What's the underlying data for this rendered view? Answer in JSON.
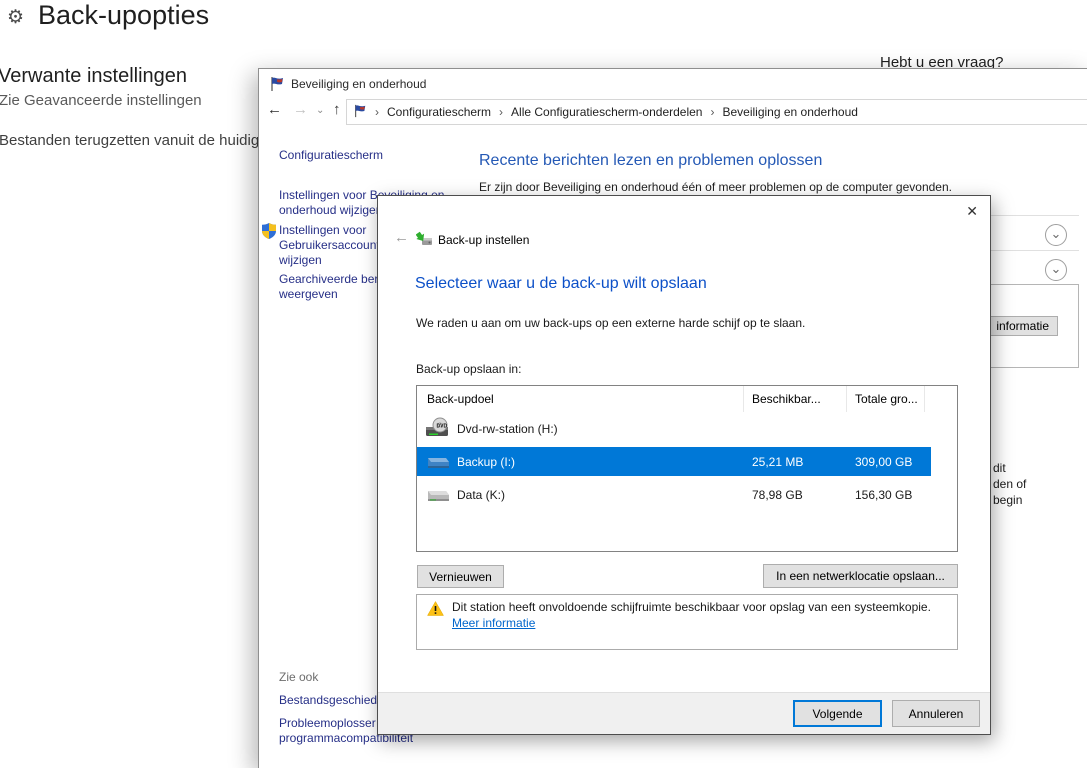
{
  "colors": {
    "accent": "#0078d7",
    "link": "#0066cc",
    "heading": "#0c50c8",
    "heading2": "#2559b5",
    "sidelink": "#262f87",
    "warn": "#fdc116"
  },
  "icons": {
    "gear": "⚙",
    "back-arrow": "←",
    "forward-arrow": "→",
    "up-arrow": "↑",
    "chevron-down": "⌄",
    "breadcrumb-separator": "›",
    "close": "✕"
  },
  "settings": {
    "title": "Back-upopties",
    "related_heading": "Verwante instellingen",
    "related_link1": "Zie Geavanceerde instellingen",
    "related_link2": "Bestanden terugzetten vanuit de huidige back-up",
    "help_heading": "Hebt u een vraag?"
  },
  "control_panel": {
    "window_title": "Beveiliging en onderhoud",
    "breadcrumb": {
      "item1": "Configuratiescherm",
      "item2": "Alle Configuratiescherm-onderdelen",
      "item3": "Beveiliging en onderhoud"
    },
    "sidebar": {
      "home": "Configuratiescherm",
      "item2": {
        "lines": [
          "Instellingen voor Beveiliging en",
          "onderhoud wijzigen"
        ]
      },
      "item3": {
        "lines": [
          "Instellingen voor",
          "Gebruikersaccountbeheer",
          "wijzigen"
        ]
      },
      "item4": {
        "lines": [
          "Gearchiveerde berichten",
          "weergeven"
        ]
      },
      "see_also": "Zie ook",
      "item5": {
        "lines": [
          "Bestandsgeschiedenis"
        ]
      },
      "item6": {
        "lines": [
          "Probleemoplosser voor",
          "programmacompatibiliteit"
        ]
      }
    },
    "main": {
      "heading": "Recente berichten lezen en problemen oplossen",
      "subtext": "Er zijn door Beveiliging en onderhoud één of meer problemen op de computer gevonden.",
      "info_button_fragment": "informatie",
      "fragment1": "dit",
      "fragment2": "den of",
      "fragment3": "begin"
    }
  },
  "dialog": {
    "nav_title": "Back-up instellen",
    "heading": "Selecteer waar u de back-up wilt opslaan",
    "subtext": "We raden u aan om uw back-ups op een externe harde schijf op te slaan.",
    "list_label": "Back-up opslaan in:",
    "columns": {
      "target": "Back-updoel",
      "available": "Beschikbar...",
      "total": "Totale gro..."
    },
    "drives": [
      {
        "name": "Dvd-rw-station (H:)",
        "available": "",
        "total": "",
        "icon": "dvd-drive-icon",
        "selected": false
      },
      {
        "name": "Backup (I:)",
        "available": "25,21 MB",
        "total": "309,00 GB",
        "icon": "blue-drive-icon",
        "selected": true
      },
      {
        "name": "Data (K:)",
        "available": "78,98 GB",
        "total": "156,30 GB",
        "icon": "gray-drive-icon",
        "selected": false
      }
    ],
    "refresh_button": "Vernieuwen",
    "network_button": "In een netwerklocatie opslaan...",
    "warning_text": "Dit station heeft onvoldoende schijfruimte beschikbaar voor opslag van een systeemkopie.",
    "warning_link": "Meer informatie",
    "next_button": "Volgende",
    "cancel_button": "Annuleren"
  }
}
